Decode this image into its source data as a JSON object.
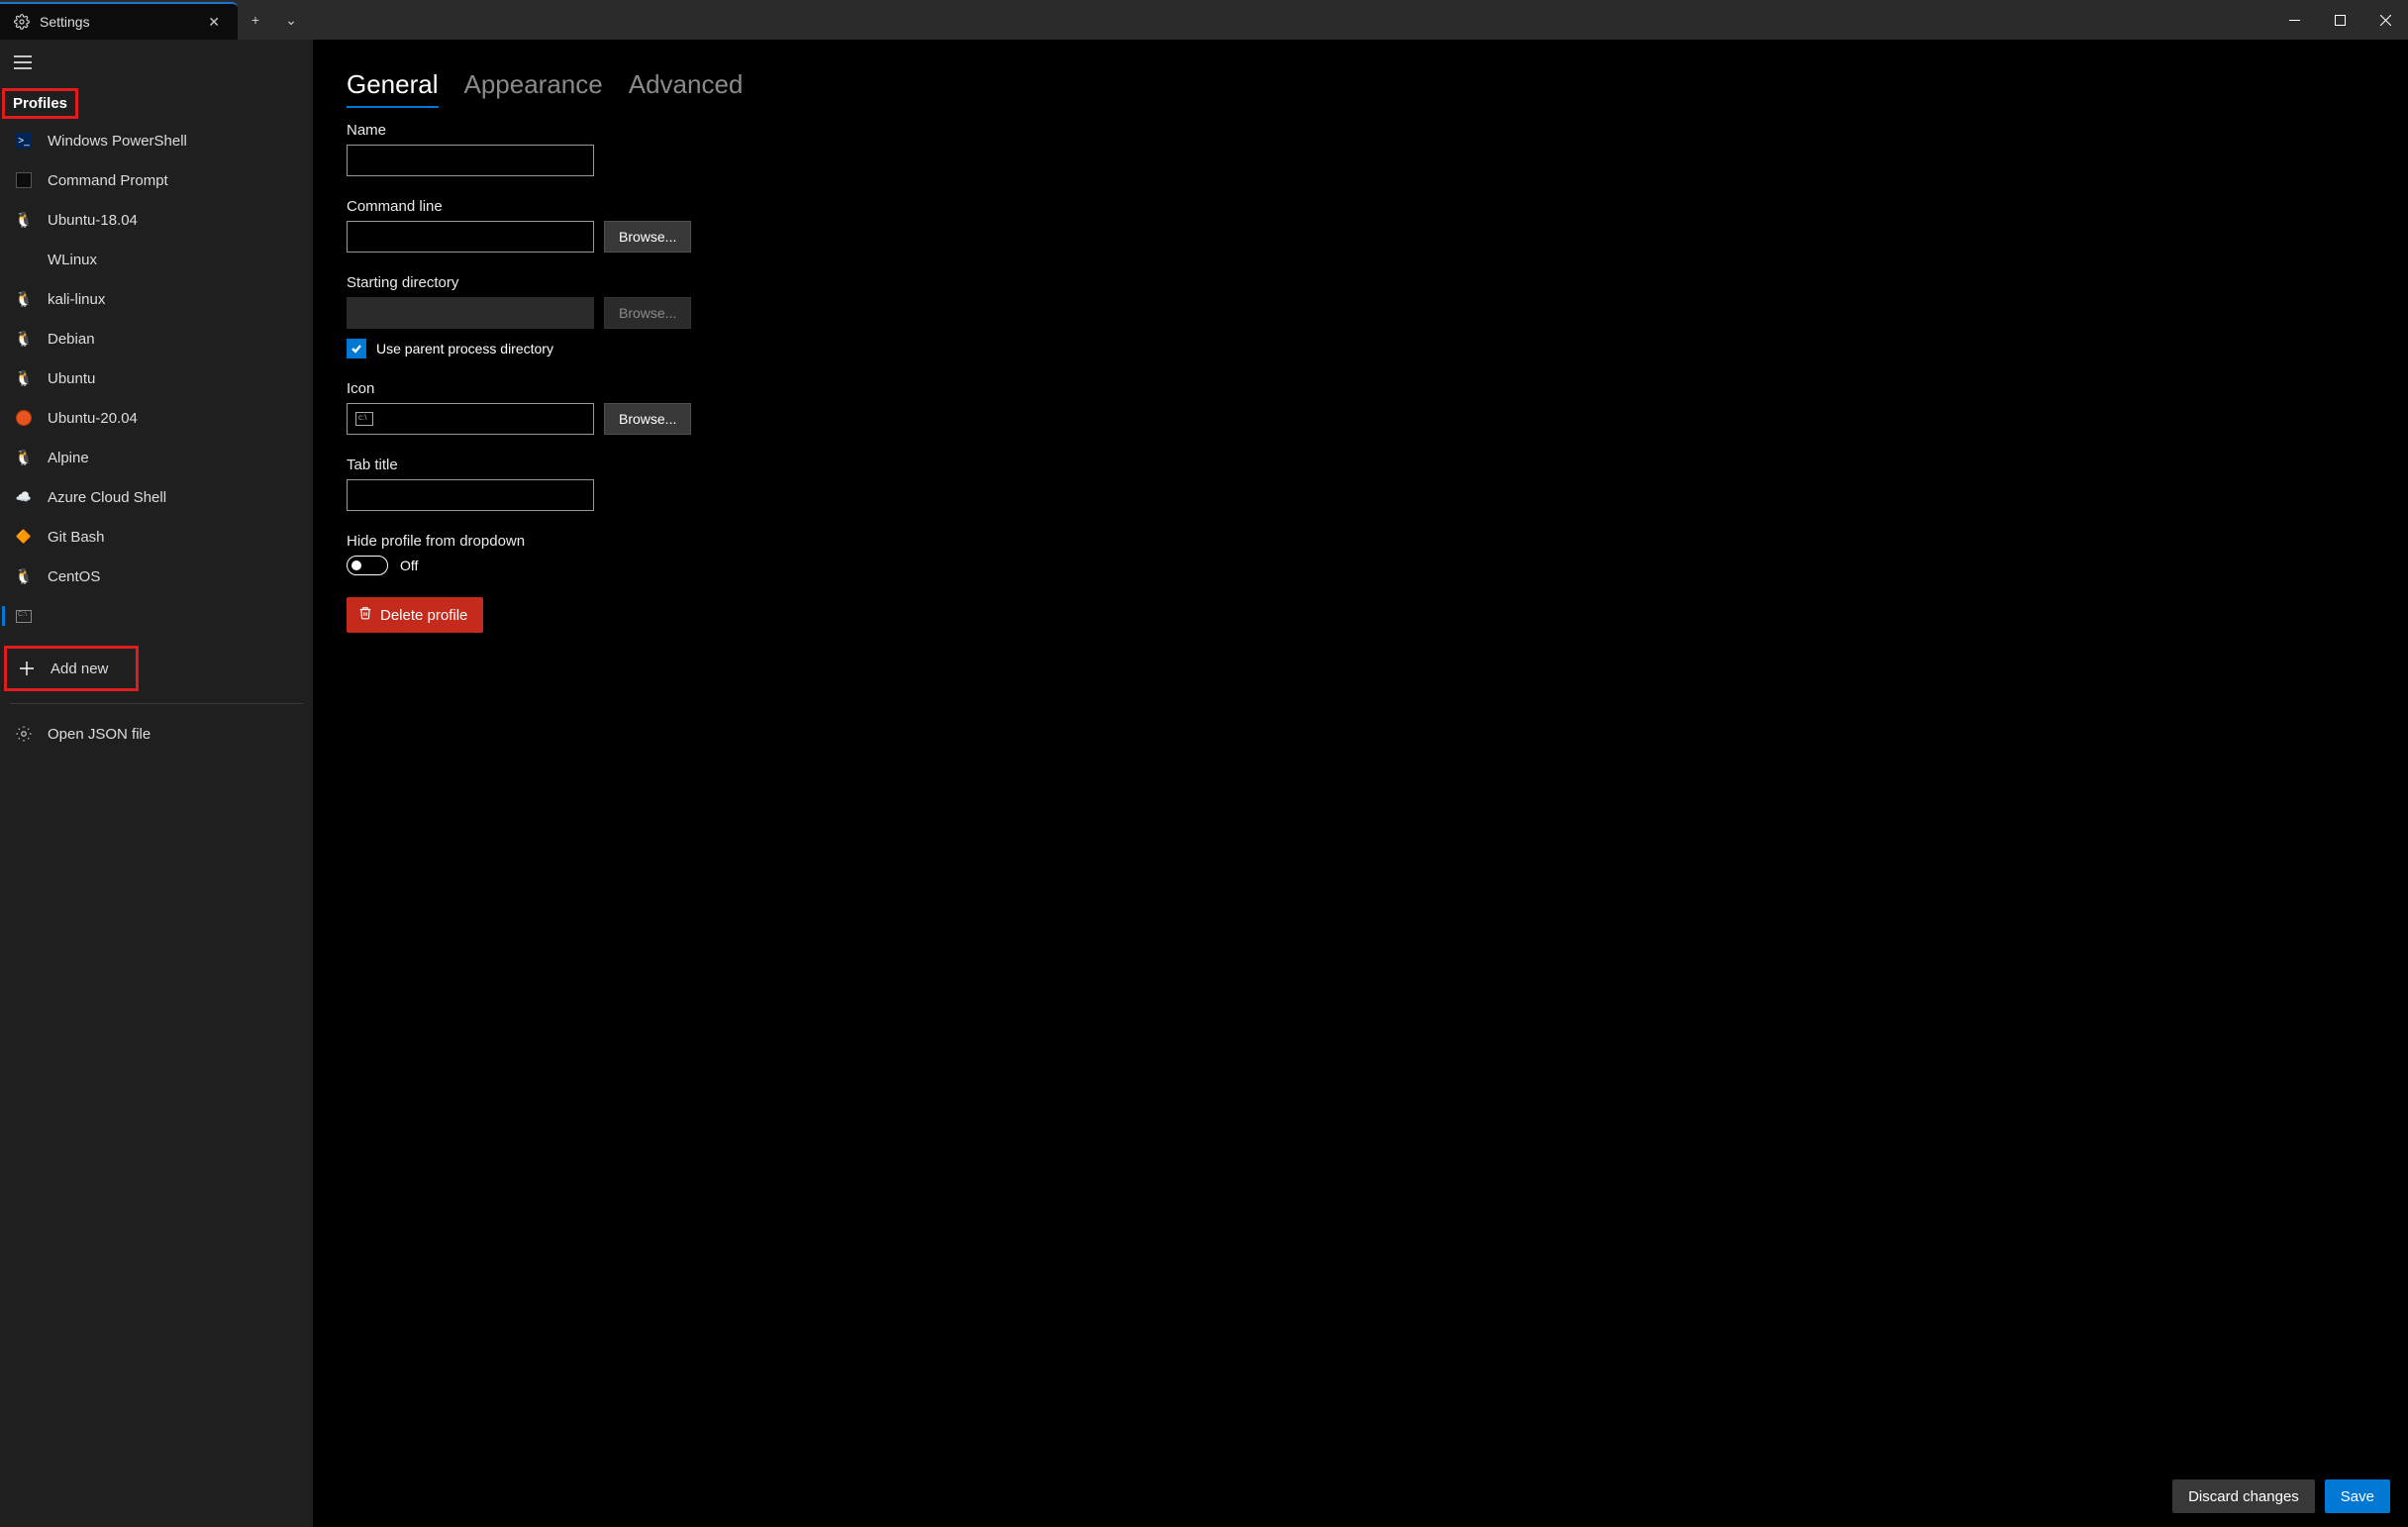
{
  "tab": {
    "title": "Settings",
    "close_glyph": "✕"
  },
  "tab_actions": {
    "new": "+",
    "dropdown": "⌄"
  },
  "sidebar": {
    "section_label": "Profiles",
    "profiles": [
      {
        "label": "Windows PowerShell",
        "icon": "powershell"
      },
      {
        "label": "Command Prompt",
        "icon": "cmd"
      },
      {
        "label": "Ubuntu-18.04",
        "icon": "tux"
      },
      {
        "label": "WLinux",
        "icon": "none"
      },
      {
        "label": "kali-linux",
        "icon": "tux"
      },
      {
        "label": "Debian",
        "icon": "tux"
      },
      {
        "label": "Ubuntu",
        "icon": "tux"
      },
      {
        "label": "Ubuntu-20.04",
        "icon": "ubuntu"
      },
      {
        "label": "Alpine",
        "icon": "tux"
      },
      {
        "label": "Azure Cloud Shell",
        "icon": "azure"
      },
      {
        "label": "Git Bash",
        "icon": "git"
      },
      {
        "label": "CentOS",
        "icon": "tux"
      }
    ],
    "selected_index": 12,
    "add_new": "Add new",
    "open_json": "Open JSON file"
  },
  "pivot": {
    "items": [
      "General",
      "Appearance",
      "Advanced"
    ],
    "active_index": 0
  },
  "form": {
    "name_label": "Name",
    "name_value": "",
    "cmdline_label": "Command line",
    "cmdline_value": "",
    "browse_label": "Browse...",
    "startdir_label": "Starting directory",
    "startdir_value": "",
    "use_parent_label": "Use parent process directory",
    "use_parent_checked": true,
    "icon_label": "Icon",
    "tabtitle_label": "Tab title",
    "tabtitle_value": "",
    "hide_label": "Hide profile from dropdown",
    "hide_state": "Off",
    "delete_label": "Delete profile"
  },
  "footer": {
    "discard": "Discard changes",
    "save": "Save"
  }
}
